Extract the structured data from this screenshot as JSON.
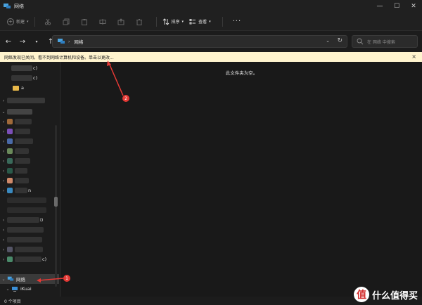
{
  "window": {
    "title": "网络"
  },
  "toolbar": {
    "new_label": "新建",
    "sort_label": "排序",
    "view_label": "查看",
    "more_label": "···"
  },
  "address": {
    "crumb": "网络",
    "separator": "›"
  },
  "search": {
    "placeholder": "在 网络 中搜索"
  },
  "infobar": {
    "message": "网络发现已关闭。看不到网络计算机和设备。单击以更改...",
    "close": "×"
  },
  "content": {
    "empty_text": "此文件夹为空。"
  },
  "sidebar": {
    "network_label": "网络",
    "ikuai_label": "iKuai",
    "partial_labels": [
      "c)",
      "c)",
      "a",
      "n",
      "i)",
      "c)"
    ]
  },
  "status": {
    "item_count": "0 个项目"
  },
  "annotations": {
    "one": "1",
    "two": "2"
  },
  "watermark": {
    "logo": "值",
    "text": "什么值得买"
  },
  "colors": {
    "infobar_bg": "#fff4ce",
    "annotation": "#e53935",
    "background": "#1c1c1c"
  }
}
